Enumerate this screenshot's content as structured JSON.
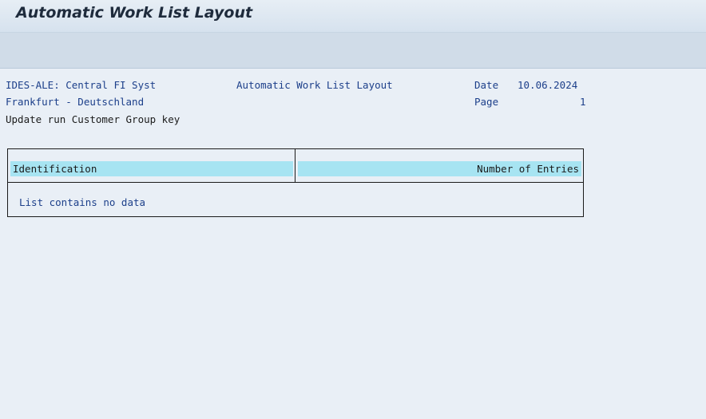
{
  "window": {
    "title": "Automatic Work List Layout"
  },
  "report_header": {
    "system": "IDES-ALE: Central FI Syst",
    "report_title": "Automatic Work List Layout",
    "date_label": "Date",
    "date_value": "10.06.2024",
    "location": "Frankfurt - Deutschland",
    "page_label": "Page",
    "page_value": "1",
    "run_description": "Update run Customer Group key"
  },
  "table": {
    "columns": [
      "Identification",
      "Number of Entries"
    ],
    "empty_message": "List contains no data"
  },
  "colors": {
    "background": "#e9eff6",
    "toolbar": "#d0dce8",
    "header_cell": "#a7e4f2",
    "text_blue": "#1c3f8a",
    "text_dark": "#1b1b1b"
  }
}
